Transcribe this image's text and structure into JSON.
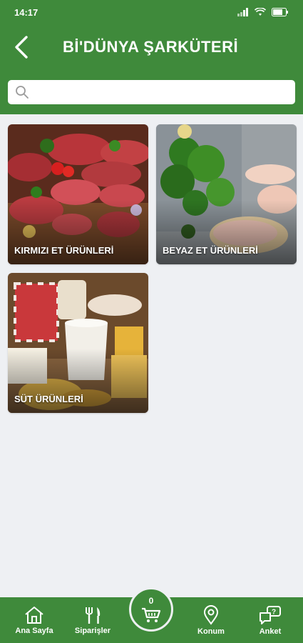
{
  "status_bar": {
    "time": "14:17"
  },
  "header": {
    "title": "Bİ'DÜNYA ŞARKÜTERİ"
  },
  "search": {
    "placeholder": "",
    "value": ""
  },
  "categories": [
    {
      "label": "KIRMIZI ET ÜRÜNLERİ"
    },
    {
      "label": "BEYAZ ET ÜRÜNLERİ"
    },
    {
      "label": "SÜT ÜRÜNLERİ"
    }
  ],
  "bottom_nav": {
    "home": "Ana Sayfa",
    "orders": "Siparişler",
    "cart_count": "0",
    "location": "Konum",
    "survey": "Anket"
  },
  "colors": {
    "primary": "#3f8a3b",
    "background": "#eef0f3"
  }
}
